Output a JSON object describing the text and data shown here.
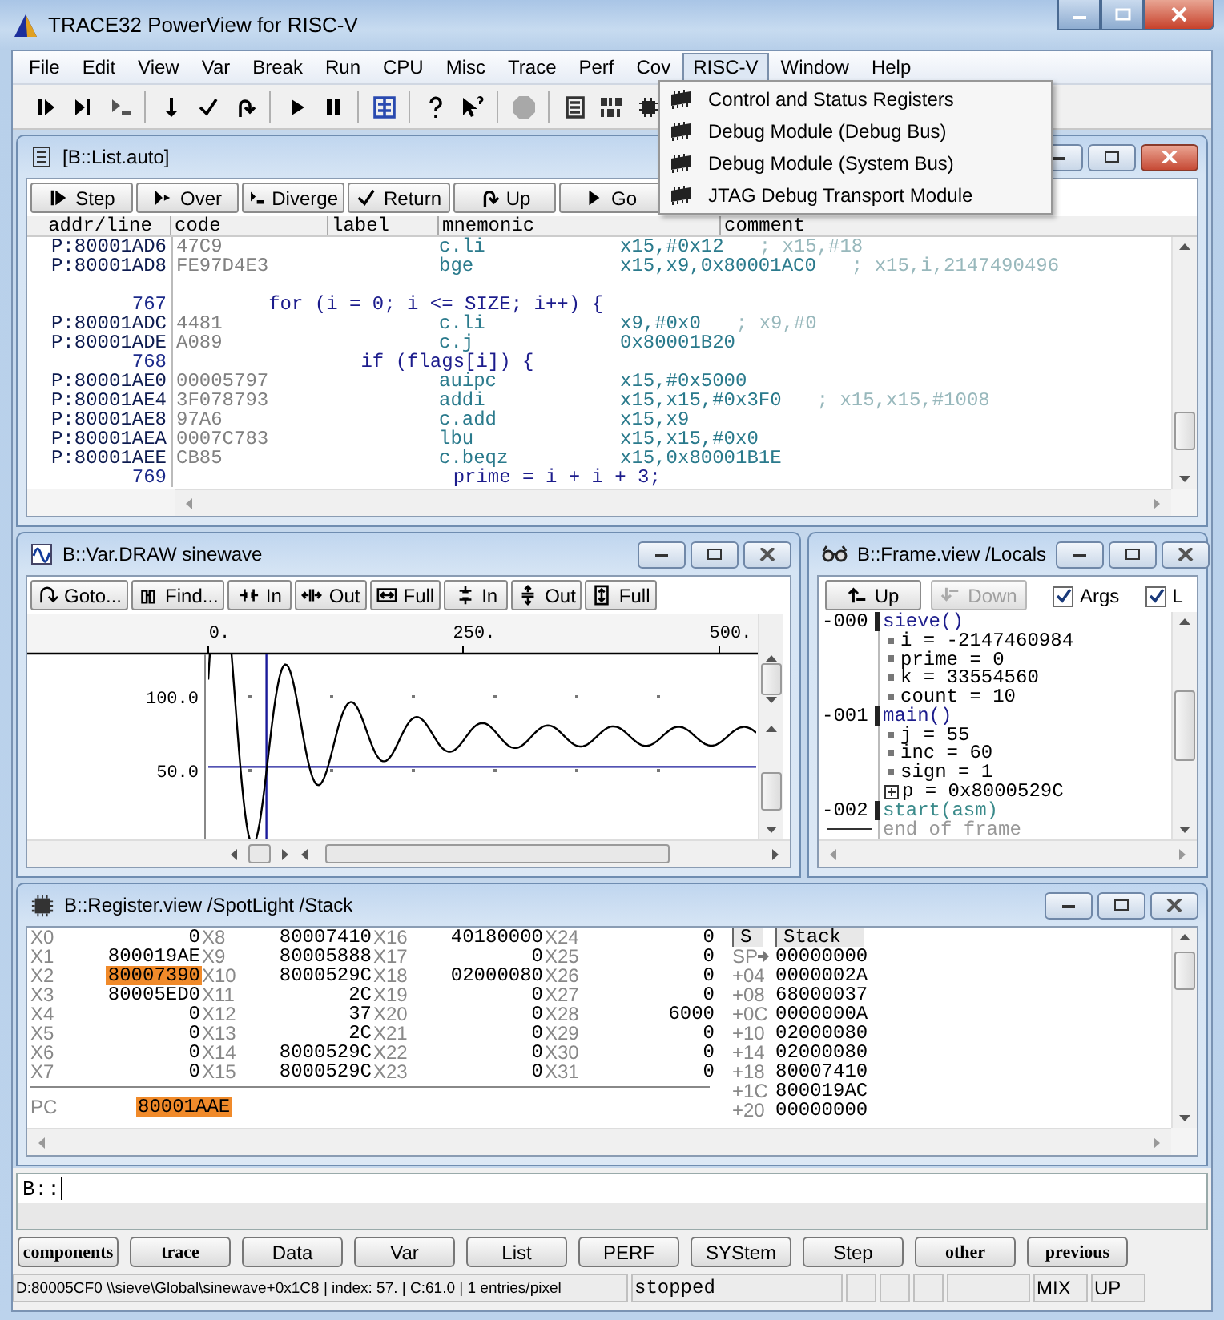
{
  "window": {
    "title": "TRACE32 PowerView for RISC-V"
  },
  "menu": [
    {
      "label": "File",
      "selected": false
    },
    {
      "label": "Edit",
      "selected": false
    },
    {
      "label": "View",
      "selected": false
    },
    {
      "label": "Var",
      "selected": false
    },
    {
      "label": "Break",
      "selected": false
    },
    {
      "label": "Run",
      "selected": false
    },
    {
      "label": "CPU",
      "selected": false
    },
    {
      "label": "Misc",
      "selected": false
    },
    {
      "label": "Trace",
      "selected": false
    },
    {
      "label": "Perf",
      "selected": false
    },
    {
      "label": "Cov",
      "selected": false
    },
    {
      "label": "RISC-V",
      "selected": true
    },
    {
      "label": "Window",
      "selected": false
    },
    {
      "label": "Help",
      "selected": false
    }
  ],
  "dropdown": {
    "items": [
      "Control and Status Registers",
      "Debug Module (Debug Bus)",
      "Debug Module (System Bus)",
      "JTAG Debug Transport Module"
    ]
  },
  "list_window": {
    "title": "[B::List.auto]",
    "active": true,
    "buttons": [
      "Step",
      "Over",
      "Diverge",
      "Return",
      "Up",
      "Go"
    ],
    "columns": [
      "addr/line",
      "code",
      "label",
      "mnemonic",
      "comment"
    ],
    "rows": [
      {
        "kind": "asm",
        "addr": "P:80001AD6",
        "code": "47C9",
        "mnemonic": "c.li",
        "operands": "x15,#0x12",
        "comment": "; x15,#18"
      },
      {
        "kind": "asm",
        "addr": "P:80001AD8",
        "code": "FE97D4E3",
        "mnemonic": "bge",
        "operands": "x15,x9,0x80001AC0",
        "comment": "; x15,i,2147490496"
      },
      {
        "kind": "gap"
      },
      {
        "kind": "src",
        "line": "767",
        "text": "        for (i = 0; i <= SIZE; i++) {"
      },
      {
        "kind": "asm",
        "addr": "P:80001ADC",
        "code": "4481",
        "mnemonic": "c.li",
        "operands": "x9,#0x0",
        "comment": "; x9,#0"
      },
      {
        "kind": "asm",
        "addr": "P:80001ADE",
        "code": "A089",
        "mnemonic": "c.j",
        "operands": "0x80001B20"
      },
      {
        "kind": "src",
        "line": "768",
        "text": "                if (flags[i]) {"
      },
      {
        "kind": "asm",
        "addr": "P:80001AE0",
        "code": "00005797",
        "mnemonic": "auipc",
        "operands": "x15,#0x5000"
      },
      {
        "kind": "asm",
        "addr": "P:80001AE4",
        "code": "3F078793",
        "mnemonic": "addi",
        "operands": "x15,x15,#0x3F0",
        "comment": "; x15,x15,#1008"
      },
      {
        "kind": "asm",
        "addr": "P:80001AE8",
        "code": "97A6",
        "mnemonic": "c.add",
        "operands": "x15,x9"
      },
      {
        "kind": "asm",
        "addr": "P:80001AEA",
        "code": "0007C783",
        "mnemonic": "lbu",
        "operands": "x15,x15,#0x0"
      },
      {
        "kind": "asm",
        "addr": "P:80001AEE",
        "code": "CB85",
        "mnemonic": "c.beqz",
        "operands": "x15,0x80001B1E"
      },
      {
        "kind": "src",
        "line": "769",
        "text": "                        prime = i + i + 3;"
      }
    ]
  },
  "var_window": {
    "title": "B::Var.DRAW sinewave",
    "active": false,
    "buttons": [
      "Goto...",
      "Find...",
      "In",
      "Out",
      "Full",
      "In",
      "Out",
      "Full"
    ],
    "plot": {
      "x_labels": [
        "0.",
        "250.",
        "500."
      ],
      "y_labels": [
        "100.0",
        "50.0"
      ]
    }
  },
  "frame_window": {
    "title": "B::Frame.view /Locals",
    "active": false,
    "buttons": [
      {
        "label": "Up",
        "disabled": false
      },
      {
        "label": "Down",
        "disabled": true
      }
    ],
    "options": [
      {
        "label": "Args",
        "checked": true
      },
      {
        "label": "L",
        "checked": true
      }
    ],
    "frames": [
      {
        "level": "-000",
        "function": "sieve()",
        "kind": "c",
        "locals": [
          {
            "text": "i = -2147460984",
            "expandable": false
          },
          {
            "text": "prime = 0",
            "expandable": false
          },
          {
            "text": "k = 33554560",
            "expandable": false
          },
          {
            "text": "count = 10",
            "expandable": false
          }
        ]
      },
      {
        "level": "-001",
        "function": "main()",
        "kind": "c",
        "locals": [
          {
            "text": "j = 55",
            "expandable": false
          },
          {
            "text": "inc = 60",
            "expandable": false
          },
          {
            "text": "sign = 1",
            "expandable": false
          },
          {
            "text": "p = 0x8000529C",
            "expandable": true
          }
        ]
      },
      {
        "level": "-002",
        "function": "start(asm)",
        "kind": "asm"
      }
    ],
    "end_text": "end of frame"
  },
  "register_window": {
    "title": "B::Register.view /SpotLight /Stack",
    "active": false,
    "columns": [
      [
        {
          "name": "X0",
          "value": "0",
          "changed": false
        },
        {
          "name": "X1",
          "value": "800019AE",
          "changed": false
        },
        {
          "name": "X2",
          "value": "80007390",
          "changed": true
        },
        {
          "name": "X3",
          "value": "80005ED0",
          "changed": false
        },
        {
          "name": "X4",
          "value": "0",
          "changed": false
        },
        {
          "name": "X5",
          "value": "0",
          "changed": false
        },
        {
          "name": "X6",
          "value": "0",
          "changed": false
        },
        {
          "name": "X7",
          "value": "0",
          "changed": false
        }
      ],
      [
        {
          "name": "X8",
          "value": "80007410",
          "changed": false
        },
        {
          "name": "X9",
          "value": "80005888",
          "changed": false
        },
        {
          "name": "X10",
          "value": "8000529C",
          "changed": false
        },
        {
          "name": "X11",
          "value": "2C",
          "changed": false
        },
        {
          "name": "X12",
          "value": "37",
          "changed": false
        },
        {
          "name": "X13",
          "value": "2C",
          "changed": false
        },
        {
          "name": "X14",
          "value": "8000529C",
          "changed": false
        },
        {
          "name": "X15",
          "value": "8000529C",
          "changed": false
        }
      ],
      [
        {
          "name": "X16",
          "value": "40180000",
          "changed": false
        },
        {
          "name": "X17",
          "value": "0",
          "changed": false
        },
        {
          "name": "X18",
          "value": "02000080",
          "changed": false
        },
        {
          "name": "X19",
          "value": "0",
          "changed": false
        },
        {
          "name": "X20",
          "value": "0",
          "changed": false
        },
        {
          "name": "X21",
          "value": "0",
          "changed": false
        },
        {
          "name": "X22",
          "value": "0",
          "changed": false
        },
        {
          "name": "X23",
          "value": "0",
          "changed": false
        }
      ],
      [
        {
          "name": "X24",
          "value": "0",
          "changed": false
        },
        {
          "name": "X25",
          "value": "0",
          "changed": false
        },
        {
          "name": "X26",
          "value": "0",
          "changed": false
        },
        {
          "name": "X27",
          "value": "0",
          "changed": false
        },
        {
          "name": "X28",
          "value": "6000",
          "changed": false
        },
        {
          "name": "X29",
          "value": "0",
          "changed": false
        },
        {
          "name": "X30",
          "value": "0",
          "changed": false
        },
        {
          "name": "X31",
          "value": "0",
          "changed": false
        }
      ]
    ],
    "pc": {
      "name": "PC",
      "value": "80001AAE",
      "changed": true
    },
    "stack_header": [
      "S",
      "Stack"
    ],
    "stack": [
      {
        "offset": "SP",
        "value": "00000000",
        "kind": "sp"
      },
      {
        "offset": "+04",
        "value": "0000002A",
        "kind": "offset"
      },
      {
        "offset": "+08",
        "value": "68000037",
        "kind": "offset"
      },
      {
        "offset": "+0C",
        "value": "0000000A",
        "kind": "offset"
      },
      {
        "offset": "+10",
        "value": "02000080",
        "kind": "offset"
      },
      {
        "offset": "+14",
        "value": "02000080",
        "kind": "offset"
      },
      {
        "offset": "+18",
        "value": "80007410",
        "kind": "offset"
      },
      {
        "offset": "+1C",
        "value": "800019AC",
        "kind": "offset"
      },
      {
        "offset": "+20",
        "value": "00000000",
        "kind": "offset"
      }
    ]
  },
  "command_line": {
    "prompt": "B::"
  },
  "softkeys": [
    {
      "label": "components",
      "kind": "group"
    },
    {
      "label": "trace",
      "kind": "group"
    },
    {
      "label": "Data",
      "kind": "command"
    },
    {
      "label": "Var",
      "kind": "command"
    },
    {
      "label": "List",
      "kind": "command"
    },
    {
      "label": "PERF",
      "kind": "command"
    },
    {
      "label": "SYStem",
      "kind": "command"
    },
    {
      "label": "Step",
      "kind": "command"
    },
    {
      "label": "other",
      "kind": "group"
    },
    {
      "label": "previous",
      "kind": "group"
    }
  ],
  "status_bar": {
    "location": "D:80005CF0  \\\\sieve\\Global\\sinewave+0x1C8 | index: 57. | C:61.0 | 1 entries/pixel",
    "state": "stopped",
    "mode": "MIX",
    "direction": "UP"
  }
}
